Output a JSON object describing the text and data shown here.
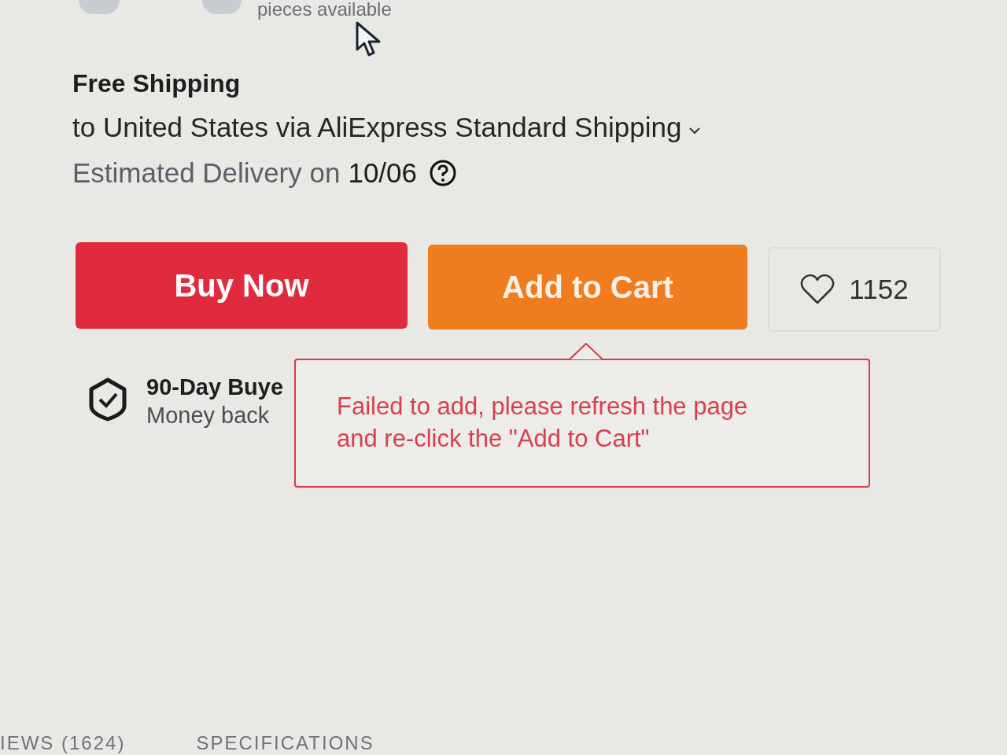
{
  "quantity": {
    "availability": "pieces available"
  },
  "shipping": {
    "title": "Free Shipping",
    "method": "to United States via AliExpress Standard Shipping",
    "estimate_label": "Estimated Delivery on",
    "estimate_date": "10/06"
  },
  "actions": [
    {
      "kind": "buy",
      "label": "Buy Now"
    },
    {
      "kind": "cart",
      "label": "Add to Cart"
    },
    {
      "kind": "wishlist",
      "label": "1152"
    }
  ],
  "error_tooltip": {
    "message": "Failed to add, please refresh the page and re-click the \"Add to Cart\""
  },
  "guarantee": {
    "title": "90-Day Buye",
    "subtitle": "Money back"
  },
  "tabs": [
    {
      "label": "IEWS (1624)"
    },
    {
      "label": "SPECIFICATIONS"
    }
  ]
}
